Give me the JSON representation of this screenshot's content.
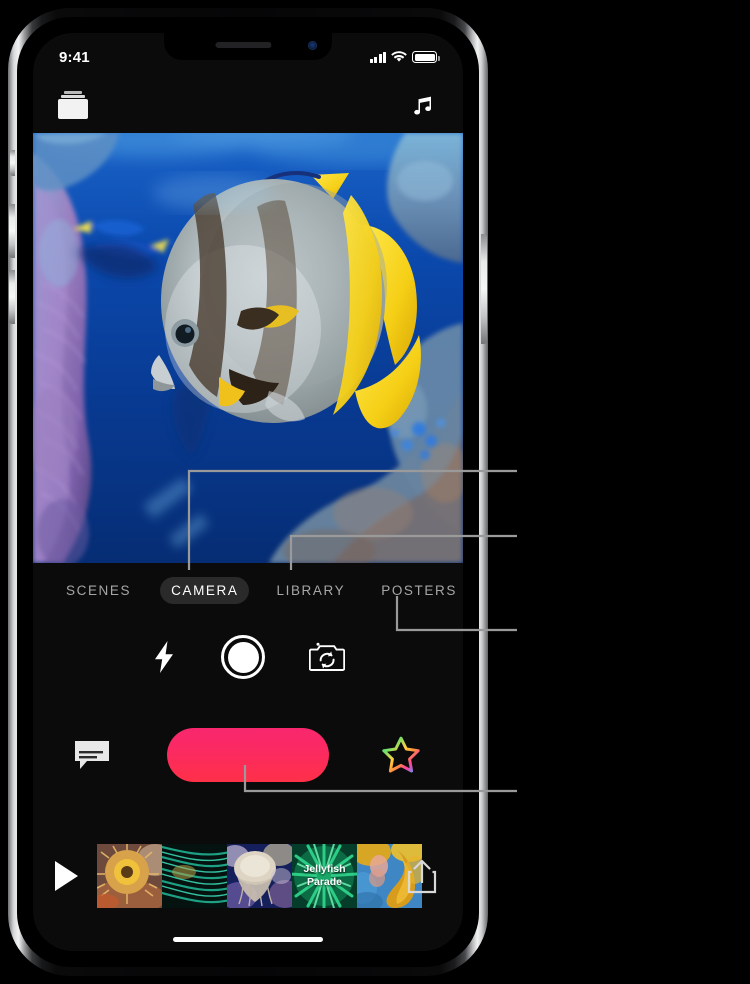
{
  "device": {
    "name": "iphone-x",
    "status_bar": {
      "time": "9:41",
      "cellular": "cellular-bars-icon",
      "wifi": "wifi-icon",
      "battery": "battery-full-icon"
    }
  },
  "top_nav": {
    "projects_icon": "projects-stack-icon",
    "music_icon": "music-note-icon"
  },
  "preview": {
    "label": "underwater-camera-preview",
    "description": "Batfish swimming near coral reef"
  },
  "tabs": [
    {
      "label": "SCENES",
      "name": "tab-scenes",
      "active": false
    },
    {
      "label": "CAMERA",
      "name": "tab-camera",
      "active": true
    },
    {
      "label": "LIBRARY",
      "name": "tab-library",
      "active": false
    },
    {
      "label": "POSTERS",
      "name": "tab-posters",
      "active": false
    }
  ],
  "camera_controls": {
    "flash": "flash-icon",
    "shutter": "shutter-button",
    "flip": "camera-flip-icon"
  },
  "record_row": {
    "teleprompter": "teleprompter-icon",
    "record": "record-button",
    "effects": "effects-star-icon",
    "record_color_top": "#F8276F",
    "record_color_bottom": "#FF3048"
  },
  "filmstrip": {
    "play": "play-icon",
    "share": "share-icon",
    "clips": [
      {
        "name": "clip-anemone",
        "title": ""
      },
      {
        "name": "clip-seagrass",
        "title": ""
      },
      {
        "name": "clip-jellyfish",
        "title": ""
      },
      {
        "name": "clip-title-card",
        "title": "Jellyfish\nParade",
        "title_line1": "Jellyfish",
        "title_line2": "Parade"
      },
      {
        "name": "clip-seahorse",
        "title": ""
      }
    ]
  },
  "callouts": [
    {
      "name": "callout-camera-tab",
      "target": "CAMERA"
    },
    {
      "name": "callout-library-tab",
      "target": "LIBRARY"
    },
    {
      "name": "callout-posters-tab",
      "target": "POSTERS"
    },
    {
      "name": "callout-record-button",
      "target": "record-button"
    }
  ],
  "colors": {
    "line": "#9a9a9a",
    "screen_bg": "#0b0b0b",
    "tab_active_bg": "#2a2a2a",
    "tab_inactive_text": "#a6a6a6"
  }
}
